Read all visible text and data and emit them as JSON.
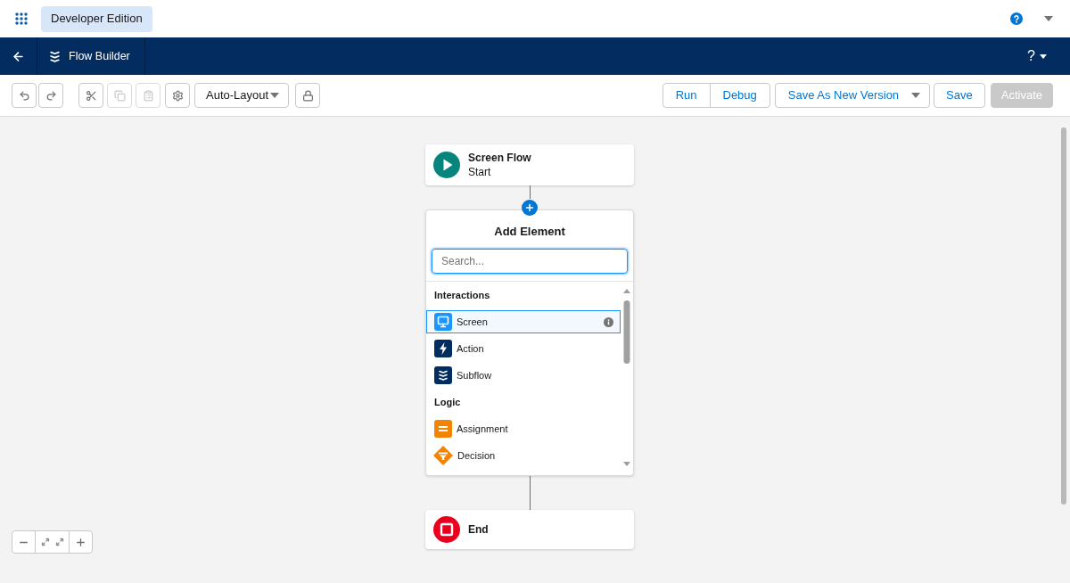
{
  "top_bar": {
    "app_name": "Developer Edition"
  },
  "nav_bar": {
    "title": "Flow Builder",
    "help": "?"
  },
  "toolbar": {
    "tools": [
      {
        "kind": "undo",
        "disabled": false
      },
      {
        "kind": "redo",
        "disabled": false
      },
      {
        "kind": "cut",
        "disabled": false
      },
      {
        "kind": "copy",
        "disabled": true
      },
      {
        "kind": "paste",
        "disabled": true
      },
      {
        "kind": "settings",
        "disabled": false
      },
      {
        "kind": "select",
        "value": "Auto-Layout",
        "disabled": false
      },
      {
        "kind": "lock",
        "disabled": false
      }
    ],
    "actions": [
      {
        "label": "Run",
        "kind": "group_start",
        "disabled": false
      },
      {
        "label": "Debug",
        "kind": "group_end",
        "disabled": false
      },
      {
        "label": "Save As New Version",
        "kind": "menu",
        "disabled": false
      },
      {
        "label": "Save",
        "kind": "button",
        "disabled": false
      },
      {
        "label": "Activate",
        "kind": "primary",
        "disabled": true
      }
    ]
  },
  "canvas": {
    "start": {
      "title": "Screen Flow",
      "subtitle": "Start"
    },
    "add_element": {
      "title": "Add Element",
      "search": {
        "placeholder": "Search..."
      },
      "sections": [
        {
          "label": "Interactions",
          "items": [
            {
              "label": "Screen",
              "kind": "screen",
              "selected": true
            },
            {
              "label": "Action",
              "kind": "action",
              "selected": false
            },
            {
              "label": "Subflow",
              "kind": "subflow",
              "selected": false
            }
          ]
        },
        {
          "label": "Logic",
          "items": [
            {
              "label": "Assignment",
              "kind": "assignment",
              "selected": false
            },
            {
              "label": "Decision",
              "kind": "decision",
              "selected": false
            }
          ]
        }
      ]
    },
    "end": {
      "title": "End"
    }
  }
}
